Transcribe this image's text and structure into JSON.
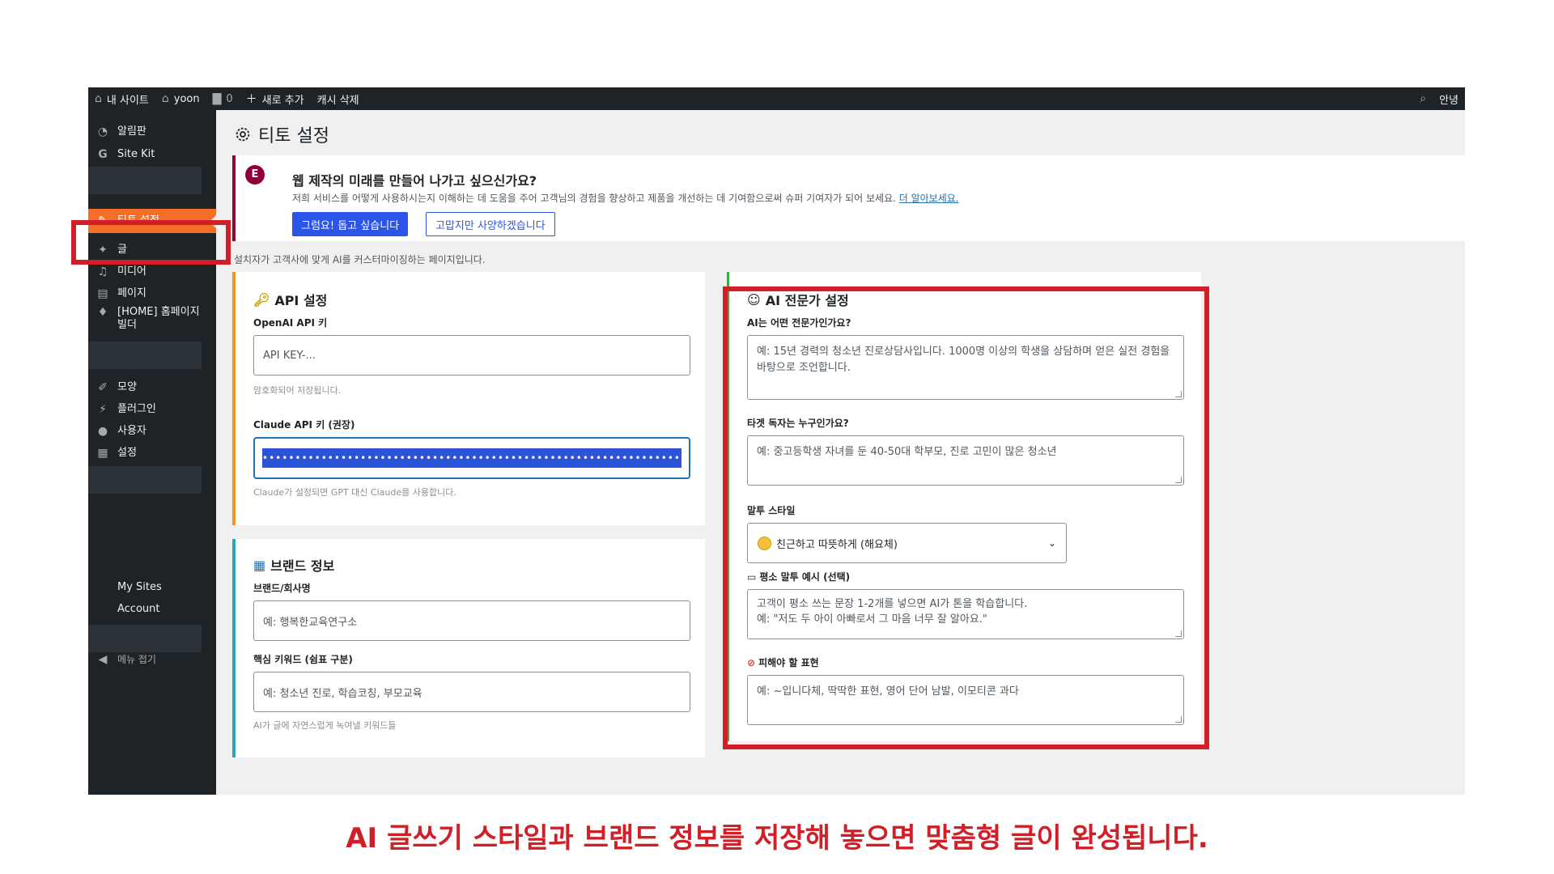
{
  "adminbar": {
    "site": "내 사이트",
    "user": "yoon",
    "comments": "0",
    "new": "새로 추가",
    "cache": "캐시 삭제",
    "right": "안녕"
  },
  "sidebar": {
    "items": [
      {
        "label": "알림판",
        "icon": "dashboard-icon"
      },
      {
        "label": "Site Kit",
        "icon": "google-g-icon"
      },
      {
        "label": "티토 설정",
        "icon": "wrench-icon"
      },
      {
        "label": "글",
        "icon": "pin-icon"
      },
      {
        "label": "미디어",
        "icon": "media-icon"
      },
      {
        "label": "페이지",
        "icon": "page-icon"
      },
      {
        "label": "[HOME] 홈페이지 빌더",
        "icon": "diamond-icon"
      },
      {
        "label": "모양",
        "icon": "brush-icon"
      },
      {
        "label": "플러그인",
        "icon": "plug-icon"
      },
      {
        "label": "사용자",
        "icon": "user-icon"
      },
      {
        "label": "설정",
        "icon": "settings-icon"
      }
    ],
    "sub": [
      "My Sites",
      "Account"
    ],
    "collapse": "메뉴 접기"
  },
  "page": {
    "title": "티토 설정",
    "desc": "설치자가 고객사에 맞게 AI를 커스터마이징하는 페이지입니다."
  },
  "notice": {
    "title": "웹 제작의 미래를 만들어 나가고 싶으신가요?",
    "desc": "저희 서비스를 어떻게 사용하시는지 이해하는 데 도움을 주어 고객님의 경험을 향상하고 제품을 개선하는 데 기여함으로써 슈퍼 기여자가 되어 보세요.",
    "link": "더 알아보세요.",
    "btn_yes": "그럼요! 돕고 싶습니다",
    "btn_no": "고맙지만 사양하겠습니다"
  },
  "api": {
    "title": "API 설정",
    "openai_label": "OpenAI API 키",
    "openai_placeholder": "API KEY-...",
    "openai_hint": "암호화되어 저장됩니다.",
    "claude_label": "Claude API 키 (권장)",
    "claude_value": "•••••••••••••••••••••••••••••••••••••••••••••••••••••••••••••••••",
    "claude_hint": "Claude가 설정되면 GPT 대신 Claude를 사용합니다."
  },
  "brand": {
    "title": "브랜드 정보",
    "name_label": "브랜드/회사명",
    "name_placeholder": "예: 행복한교육연구소",
    "kw_label": "핵심 키워드 (쉼표 구분)",
    "kw_placeholder": "예: 청소년 진로, 학습코칭, 부모교육",
    "kw_hint": "AI가 글에 자연스럽게 녹여낼 키워드들"
  },
  "expert": {
    "title": "AI 전문가 설정",
    "q1_label": "AI는 어떤 전문가인가요?",
    "q1_placeholder": "예: 15년 경력의 청소년 진로상담사입니다. 1000명 이상의 학생을 상담하며 얻은 실전 경험을 바탕으로 조언합니다.",
    "q2_label": "타겟 독자는 누구인가요?",
    "q2_placeholder": "예: 중고등학생 자녀를 둔 40-50대 학부모, 진로 고민이 많은 청소년",
    "tone_label": "말투 스타일",
    "tone_value": "친근하고 따뜻하게 (해요체)",
    "example_label": "평소 말투 예시 (선택)",
    "example_line1": "고객이 평소 쓰는 문장 1-2개를 넣으면 AI가 톤을 학습합니다.",
    "example_line2": "예: \"저도 두 아이 아빠로서 그 마음 너무 잘 알아요.\"",
    "avoid_label": "피해야 할 표현",
    "avoid_placeholder": "예: ~입니다체, 딱딱한 표현, 영어 단어 남발, 이모티콘 과다"
  },
  "caption": "AI 글쓰기 스타일과 브랜드 정보를 저장해 놓으면 맞춤형 글이 완성됩니다.",
  "colors": {
    "highlight": "#d01f26",
    "active_menu": "#f56e28",
    "primary_button": "#2c54e8",
    "notice_accent": "#92003b"
  }
}
